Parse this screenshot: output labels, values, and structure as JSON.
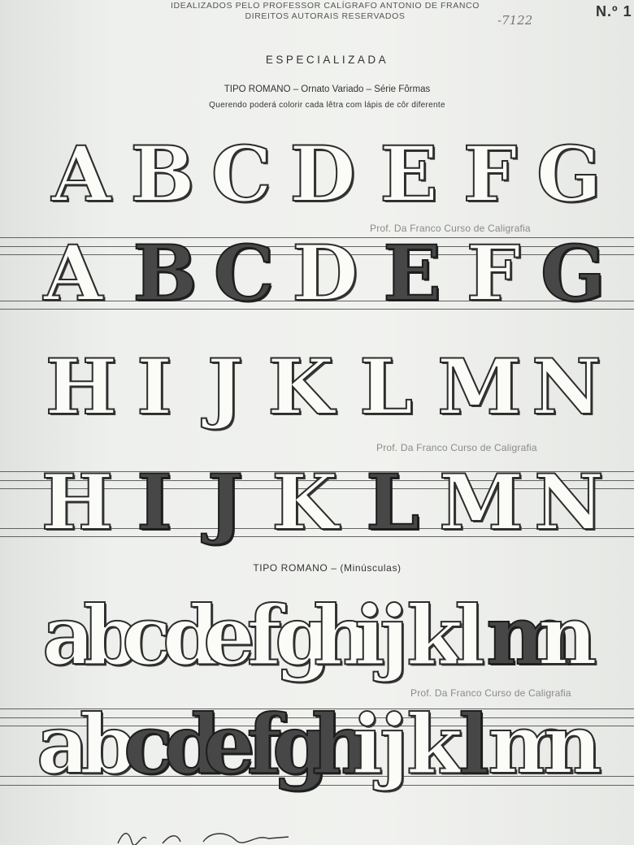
{
  "header": {
    "line1": "IDEALIZADOS PELO PROFESSOR CALÍGRAFO ANTONIO DE FRANCO",
    "line2": "DIREITOS AUTORAIS RESERVADOS",
    "handwritten_number": "-7122",
    "sheet_number": "N.º 1"
  },
  "title": "ESPECIALIZADA",
  "subtitle": "TIPO ROMANO – Ornato Variado – Série Fôrmas",
  "instruction": "Querendo poderá colorir cada lêtra com lápis de côr diferente",
  "section_lowercase": "TIPO ROMANO – (Minúsculas)",
  "watermark": "Prof. Da Franco Curso de Caligrafia",
  "uppercase_row1": [
    "A",
    "B",
    "C",
    "D",
    "E",
    "F",
    "G"
  ],
  "uppercase_row2": [
    "H",
    "I",
    "J",
    "K",
    "L",
    "M",
    "N"
  ],
  "lowercase_row": [
    "a",
    "b",
    "c",
    "d",
    "e",
    "f",
    "g",
    "h",
    "i",
    "j",
    "k",
    "l",
    "m",
    "n"
  ],
  "colors": {
    "ink": "#2d2d2d",
    "paper": "#eef0ed",
    "watermark": "#8a8a8a"
  }
}
